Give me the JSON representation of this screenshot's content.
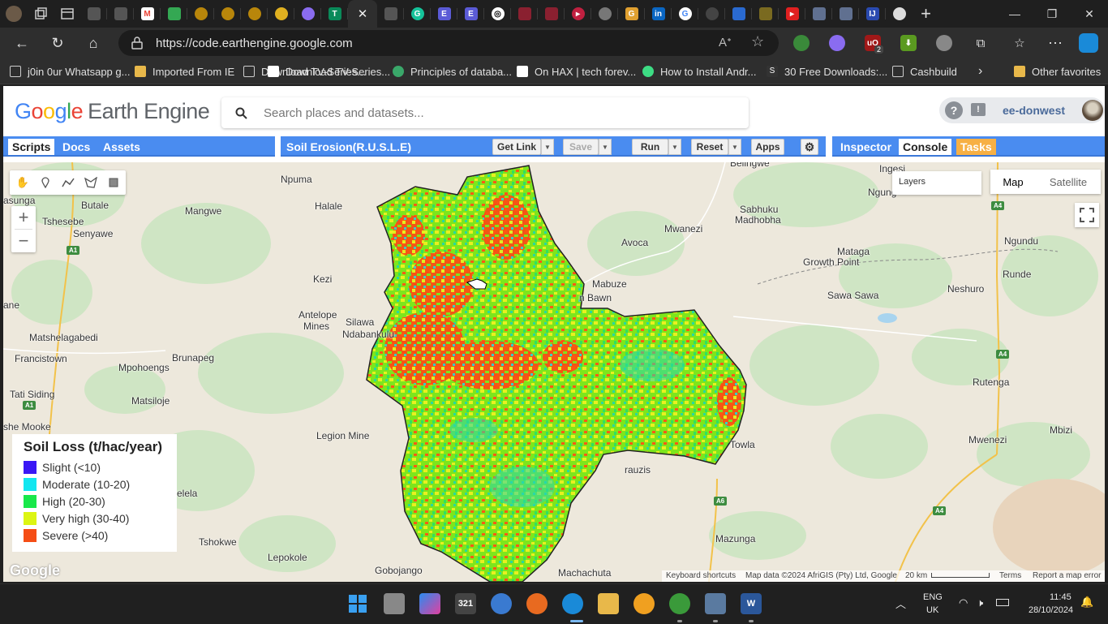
{
  "browser": {
    "address": "https://code.earthengine.google.com",
    "bookmarks": [
      "j0in 0ur Whatsapp g...",
      "Imported From IE",
      "Download TV-Series...",
      "Principles of databa...",
      "On HAX | tech forev...",
      "How to Install Andr...",
      "30 Free Downloads:...",
      "Cashbuild"
    ],
    "other_favorites": "Other favorites",
    "ext_badge": "2"
  },
  "gee": {
    "logo_google": "Google",
    "logo_product": "Earth Engine",
    "search_placeholder": "Search places and datasets...",
    "username": "ee-donwest",
    "left_tabs": [
      "Scripts",
      "Docs",
      "Assets"
    ],
    "script_title": "Soil Erosion(R.U.S.L.E)",
    "buttons": {
      "get_link": "Get Link",
      "save": "Save",
      "run": "Run",
      "reset": "Reset",
      "apps": "Apps"
    },
    "right_tabs": [
      "Inspector",
      "Console",
      "Tasks"
    ]
  },
  "map": {
    "layers_label": "Layers",
    "map_type_options": [
      "Map",
      "Satellite"
    ],
    "selected_map_type": "Map",
    "place_labels": [
      "Npuma",
      "Halale",
      "Mangwe",
      "Butale",
      "Tshesebe",
      "Senyawe",
      "asunga",
      "Kezi",
      "Antelope",
      "Mines",
      "Silawa",
      "Ndabankulu",
      "Matshelagabedi",
      "Francistown",
      "Brunapeg",
      "Mpohoengs",
      "Tati Siding",
      "Matsiloje",
      "she Mooke",
      "Legion Mine",
      "Tshokwe",
      "Lepokole",
      "Gobojango",
      "Machachuta",
      "Mazunga",
      "Avoca",
      "Mwanezi",
      "Sabhuku",
      "Madhobha",
      "Mabuze",
      "n Bawn",
      "Mataga",
      "Growth Point",
      "Sawa Sawa",
      "Neshuro",
      "Ngundu",
      "Runde",
      "Rutenga",
      "Mwenezi",
      "Mbizi",
      "Towla",
      "rauzis",
      "Ingesi",
      "Ngung",
      "Belingwe",
      "ane",
      "elela"
    ],
    "road_shields": [
      "A1",
      "A1",
      "A4",
      "A4",
      "A4",
      "A6"
    ],
    "legend": {
      "title": "Soil Loss (t/hac/year)",
      "classes": [
        {
          "label": "Slight (<10)",
          "color": "#3a17f5"
        },
        {
          "label": "Moderate (10-20)",
          "color": "#12e6f0"
        },
        {
          "label": "High (20-30)",
          "color": "#18e84a"
        },
        {
          "label": "Very high (30-40)",
          "color": "#dcf513"
        },
        {
          "label": "Severe (>40)",
          "color": "#f54d15"
        }
      ]
    },
    "attribution": {
      "shortcuts": "Keyboard shortcuts",
      "data": "Map data ©2024 AfriGIS (Pty) Ltd, Google",
      "scale": "20 km",
      "terms": "Terms",
      "report": "Report a map error"
    },
    "google_mark": "Google"
  },
  "taskbar": {
    "lang": "ENG",
    "region": "UK",
    "time": "11:45",
    "date": "28/10/2024"
  }
}
